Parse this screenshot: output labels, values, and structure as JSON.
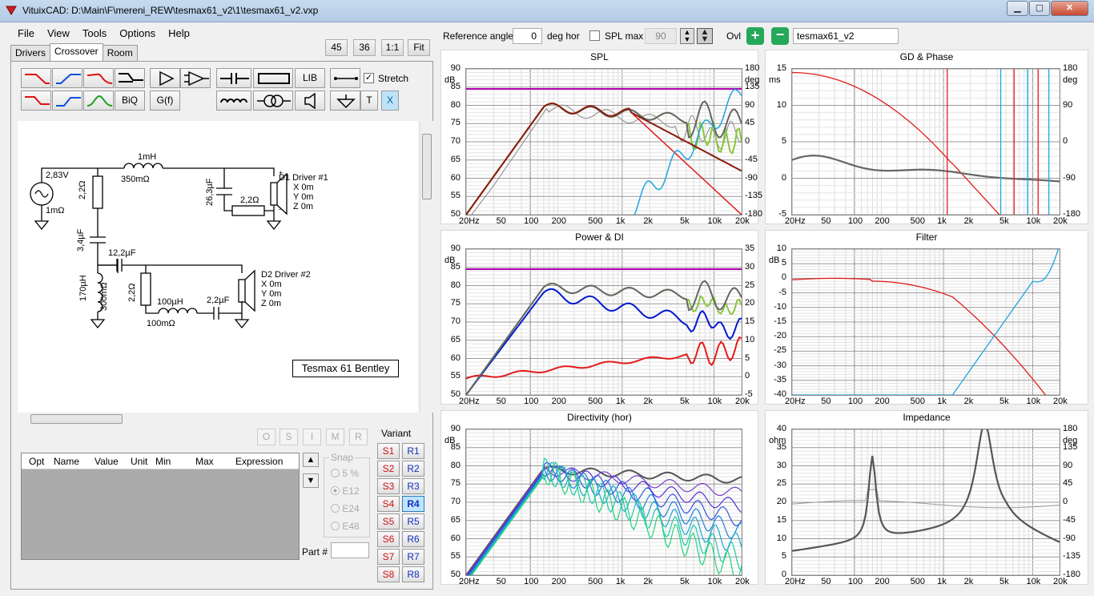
{
  "window": {
    "title": "VituixCAD: D:\\Main\\F\\mereni_REW\\tesmax61_v2\\1\\tesmax61_v2.vxp"
  },
  "menu": [
    "File",
    "View",
    "Tools",
    "Options",
    "Help"
  ],
  "zoom_buttons": [
    "45",
    "36",
    "1:1",
    "Fit"
  ],
  "tabs": [
    "Drivers",
    "Crossover",
    "Room"
  ],
  "toolbar": {
    "lib": "LIB",
    "biq": "BiQ",
    "gf": "G(f)",
    "t": "T",
    "x": "X",
    "stretch_label": "Stretch",
    "stretch_checked": true
  },
  "schematic": {
    "source_voltage": "2,83V",
    "source_resistance": "1mΩ",
    "l1": "1mH",
    "l1_r": "350mΩ",
    "r1": "2,2Ω",
    "c1": "26,3µF",
    "r_series": "2,2Ω",
    "c2": "3,4µF",
    "c3": "12,2µF",
    "l2": "170µH",
    "l2_r": "300mΩ",
    "r2": "2,2Ω",
    "l3": "100µH",
    "l3_r": "100mΩ",
    "c4": "2,2µF",
    "driver1": {
      "name": "D1 Driver #1",
      "x": "X 0m",
      "y": "Y 0m",
      "z": "Z 0m"
    },
    "driver2": {
      "name": "D2 Driver #2",
      "x": "X 0m",
      "y": "Y 0m",
      "z": "Z 0m"
    },
    "label": "Tesmax 61 Bentley"
  },
  "opt_buttons": [
    "O",
    "S",
    "I",
    "M",
    "R"
  ],
  "opt_table": {
    "headers": [
      "Opt",
      "Name",
      "Value",
      "Unit",
      "Min",
      "Max",
      "Expression"
    ]
  },
  "snap": {
    "title": "Snap",
    "options": [
      "5 %",
      "E12",
      "E24",
      "E48"
    ],
    "selected": "E12"
  },
  "part_label": "Part #",
  "variant": {
    "title": "Variant",
    "s": [
      "S1",
      "S2",
      "S3",
      "S4",
      "S5",
      "S6",
      "S7",
      "S8"
    ],
    "r": [
      "R1",
      "R2",
      "R3",
      "R4",
      "R5",
      "R6",
      "R7",
      "R8"
    ],
    "active": "R4"
  },
  "top": {
    "ref_angle_label": "Reference angle",
    "ref_angle_value": "0",
    "deg_hor": "deg hor",
    "spl_max_label": "SPL max",
    "spl_max_value": "90",
    "ovl_label": "Ovl",
    "name_value": "tesmax61_v2"
  },
  "freq_ticks": [
    "20Hz",
    "50",
    "100",
    "200",
    "500",
    "1k",
    "2k",
    "5k",
    "10k",
    "20k"
  ],
  "chart_data": [
    {
      "type": "line",
      "title": "SPL",
      "yunit": "dB",
      "y2unit": "deg",
      "ylim": [
        50,
        90
      ],
      "y2lim": [
        -180,
        180
      ],
      "yticks": [
        "90",
        "85",
        "80",
        "75",
        "70",
        "65",
        "60",
        "55",
        "50"
      ],
      "y2ticks": [
        "180",
        "135",
        "90",
        "45",
        "0",
        "-45",
        "-90",
        "-135",
        "-180"
      ]
    },
    {
      "type": "line",
      "title": "GD & Phase",
      "yunit": "ms",
      "y2unit": "deg",
      "ylim": [
        -5,
        15
      ],
      "y2lim": [
        -180,
        180
      ],
      "yticks": [
        "15",
        "10",
        "5",
        "0",
        "-5"
      ],
      "y2ticks": [
        "180",
        "90",
        "0",
        "-90",
        "-180"
      ]
    },
    {
      "type": "line",
      "title": "Power & DI",
      "yunit": "dB",
      "ylim": [
        50,
        90
      ],
      "y2lim": [
        -5,
        35
      ],
      "yticks": [
        "90",
        "85",
        "80",
        "75",
        "70",
        "65",
        "60",
        "55",
        "50"
      ],
      "y2ticks": [
        "35",
        "30",
        "25",
        "20",
        "15",
        "10",
        "5",
        "0",
        "-5"
      ]
    },
    {
      "type": "line",
      "title": "Filter",
      "yunit": "dB",
      "ylim": [
        -40,
        10
      ],
      "yticks": [
        "10",
        "5",
        "0",
        "-5",
        "-10",
        "-15",
        "-20",
        "-25",
        "-30",
        "-35",
        "-40"
      ]
    },
    {
      "type": "line",
      "title": "Directivity (hor)",
      "yunit": "dB",
      "ylim": [
        50,
        90
      ],
      "yticks": [
        "90",
        "85",
        "80",
        "75",
        "70",
        "65",
        "60",
        "55",
        "50"
      ]
    },
    {
      "type": "line",
      "title": "Impedance",
      "yunit": "ohm",
      "y2unit": "deg",
      "ylim": [
        0,
        40
      ],
      "y2lim": [
        -180,
        180
      ],
      "yticks": [
        "40",
        "35",
        "30",
        "25",
        "20",
        "15",
        "10",
        "5",
        "0"
      ],
      "y2ticks": [
        "180",
        "135",
        "90",
        "45",
        "0",
        "-45",
        "-90",
        "-135",
        "-180"
      ]
    }
  ],
  "colors": {
    "titlebar": "#b9d1ea",
    "red_ch": "#e31b1b",
    "blue_ch": "#1aa6e0",
    "sum": "#8a1c0c",
    "magenta": "#b000b0",
    "green": "#8cc63e"
  }
}
